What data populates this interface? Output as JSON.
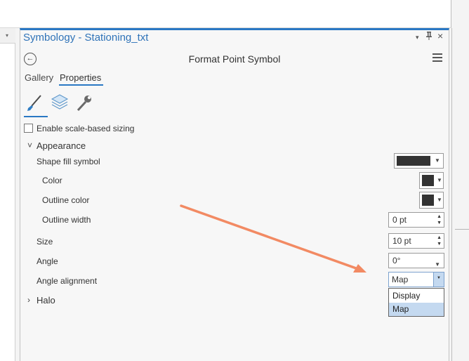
{
  "pane": {
    "title": "Symbology - Stationing_txt",
    "pin_glyph": "⍑",
    "close_glyph": "×",
    "menu_arrow_glyph": "▾"
  },
  "header": {
    "back_glyph": "←",
    "title": "Format Point Symbol"
  },
  "tabs": [
    {
      "label": "Gallery"
    },
    {
      "label": "Properties",
      "selected": true
    }
  ],
  "icon_tabs": [
    {
      "name": "brush-icon",
      "selected": true
    },
    {
      "name": "layers-icon"
    },
    {
      "name": "wrench-icon"
    }
  ],
  "scale_sizing": {
    "label": "Enable scale-based sizing",
    "checked": false
  },
  "appearance": {
    "chevron_glyph": "˅",
    "label": "Appearance",
    "shape_fill_symbol": {
      "label": "Shape fill symbol",
      "color": "#333333"
    },
    "color": {
      "label": "Color",
      "value": "#333333"
    },
    "outline_color": {
      "label": "Outline color",
      "value": "#333333"
    },
    "outline_width": {
      "label": "Outline width",
      "value": "0 pt"
    },
    "size": {
      "label": "Size",
      "value": "10 pt"
    },
    "angle": {
      "label": "Angle",
      "value": "0°"
    },
    "angle_alignment": {
      "label": "Angle alignment",
      "value": "Map",
      "options": [
        "Display",
        "Map"
      ],
      "highlighted": "Map"
    }
  },
  "halo": {
    "chevron_glyph": "›",
    "label": "Halo"
  },
  "glyphs": {
    "down": "▼",
    "up": "▲",
    "small_down": "▾"
  },
  "colors": {
    "accent": "#2a78c4",
    "annotation_arrow": "#f28a63",
    "selection": "#c4d9f0"
  }
}
